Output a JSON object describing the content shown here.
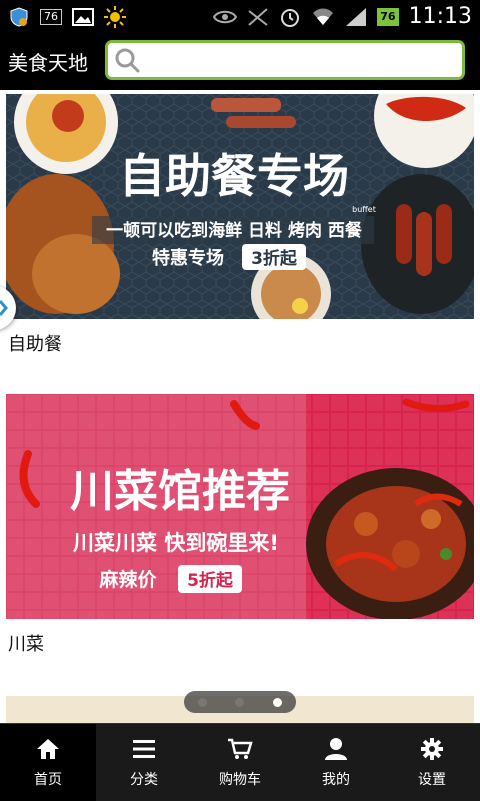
{
  "status_bar": {
    "notification_badge": "76",
    "battery": "76",
    "time": "11:13"
  },
  "header": {
    "title": "美食天地",
    "search_placeholder": ""
  },
  "banners": [
    {
      "headline": "自助餐专场",
      "subline": "一顿可以吃到海鲜 日料 烤肉 西餐",
      "promo": "特惠专场",
      "discount": "3折起",
      "tag": "buffet",
      "label": "自助餐"
    },
    {
      "headline": "川菜馆推荐",
      "subline": "川菜川菜 快到碗里来!",
      "promo": "麻辣价",
      "discount": "5折起",
      "label": "川菜"
    }
  ],
  "carousel": {
    "count": 3,
    "active_index": 2
  },
  "tabs": [
    {
      "label": "首页",
      "icon": "home-icon",
      "active": true
    },
    {
      "label": "分类",
      "icon": "list-icon",
      "active": false
    },
    {
      "label": "购物车",
      "icon": "cart-icon",
      "active": false
    },
    {
      "label": "我的",
      "icon": "user-icon",
      "active": false
    },
    {
      "label": "设置",
      "icon": "gear-icon",
      "active": false
    }
  ],
  "colors": {
    "accent_green": "#7cbb3a",
    "banner1_bg": "#2b3a48",
    "banner2_bg": "#d8234f"
  }
}
